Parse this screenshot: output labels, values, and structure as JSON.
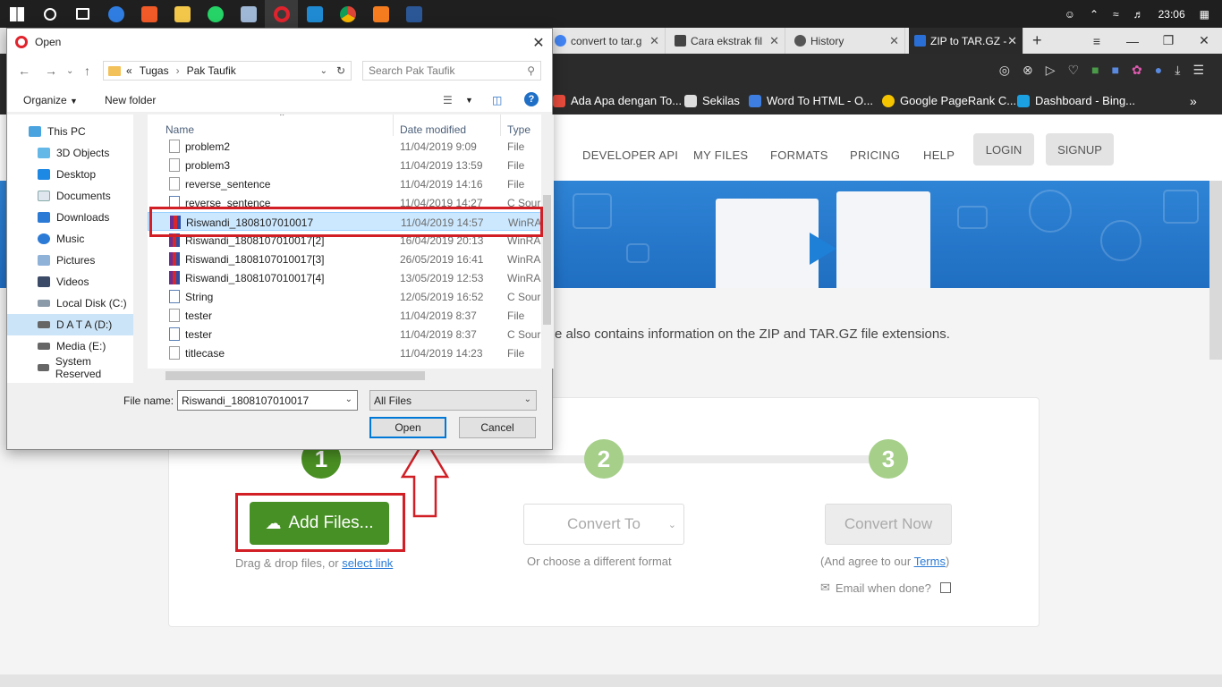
{
  "taskbar": {
    "icons": [
      "windows-start-icon",
      "search-icon",
      "task-view-icon",
      "edge-icon",
      "photo-app-icon",
      "file-explorer-icon",
      "whatsapp-icon",
      "notepad-icon",
      "opera-icon",
      "vscode-icon",
      "chrome-icon",
      "xampp-icon",
      "word-icon"
    ],
    "time": "23:06"
  },
  "browser": {
    "tabs": [
      {
        "title": "convert to tar.g",
        "icon_color": "#4285f4"
      },
      {
        "title": "Cara ekstrak fil",
        "icon_color": "#444444"
      },
      {
        "title": "History",
        "icon_color": "#555555"
      },
      {
        "title": "ZIP to TAR.GZ -",
        "icon_color": "#2a6fd6"
      }
    ],
    "bookmarks": [
      {
        "label": "Ada Apa dengan To...",
        "icon_color": "#e74c3c"
      },
      {
        "label": "Sekilas",
        "icon_color": "#dddddd"
      },
      {
        "label": "Word To HTML - O...",
        "icon_color": "#3d7ee0"
      },
      {
        "label": "Google PageRank C...",
        "icon_color": "#f5c400"
      },
      {
        "label": "Dashboard - Bing...",
        "icon_color": "#1ba1e2"
      }
    ]
  },
  "site": {
    "nav": [
      "DEVELOPER API",
      "MY FILES",
      "FORMATS",
      "PRICING",
      "HELP"
    ],
    "login": "LOGIN",
    "signup": "SIGNUP",
    "info_text": "e also contains information on the ZIP and TAR.GZ file extensions.",
    "steps": [
      "1",
      "2",
      "3"
    ],
    "add_files": "Add Files...",
    "drag_text": "Drag & drop files, or ",
    "select_link": "select link",
    "convert_to": "Convert To",
    "choose_format": "Or choose a different format",
    "convert_now": "Convert Now",
    "agree_prefix": "(And agree to our ",
    "terms": "Terms",
    "agree_suffix": ")",
    "email_when_done": "Email when done?",
    "colors": {
      "green": "#479025",
      "step_active": "#4a8f23",
      "step_inactive": "#a6cf8a",
      "hero": "#2f84d6"
    }
  },
  "dialog": {
    "title": "Open",
    "path": {
      "prefix": "«",
      "parts": [
        "Tugas",
        "Pak Taufik"
      ]
    },
    "search_placeholder": "Search Pak Taufik",
    "organize": "Organize",
    "new_folder": "New folder",
    "nav_items": [
      "This PC",
      "3D Objects",
      "Desktop",
      "Documents",
      "Downloads",
      "Music",
      "Pictures",
      "Videos",
      "Local Disk (C:)",
      "D A T A (D:)",
      "Media (E:)",
      "System Reserved"
    ],
    "columns": {
      "name": "Name",
      "date": "Date modified",
      "type": "Type"
    },
    "files": [
      {
        "name": "problem2",
        "date": "11/04/2019 9:09",
        "type": "File",
        "kind": "file"
      },
      {
        "name": "problem3",
        "date": "11/04/2019 13:59",
        "type": "File",
        "kind": "file"
      },
      {
        "name": "reverse_sentence",
        "date": "11/04/2019 14:16",
        "type": "File",
        "kind": "file"
      },
      {
        "name": "reverse_sentence",
        "date": "11/04/2019 14:27",
        "type": "C Sour",
        "kind": "c"
      },
      {
        "name": "Riswandi_1808107010017",
        "date": "11/04/2019 14:57",
        "type": "WinRA",
        "kind": "rar"
      },
      {
        "name": "Riswandi_1808107010017[2]",
        "date": "16/04/2019 20:13",
        "type": "WinRA",
        "kind": "rar"
      },
      {
        "name": "Riswandi_1808107010017[3]",
        "date": "26/05/2019 16:41",
        "type": "WinRA",
        "kind": "rar"
      },
      {
        "name": "Riswandi_1808107010017[4]",
        "date": "13/05/2019 12:53",
        "type": "WinRA",
        "kind": "rar"
      },
      {
        "name": "String",
        "date": "12/05/2019 16:52",
        "type": "C Sour",
        "kind": "c"
      },
      {
        "name": "tester",
        "date": "11/04/2019 8:37",
        "type": "File",
        "kind": "file"
      },
      {
        "name": "tester",
        "date": "11/04/2019 8:37",
        "type": "C Sour",
        "kind": "c"
      },
      {
        "name": "titlecase",
        "date": "11/04/2019 14:23",
        "type": "File",
        "kind": "file"
      }
    ],
    "file_name_label": "File name:",
    "file_name_value": "Riswandi_1808107010017",
    "file_type": "All Files",
    "open": "Open",
    "cancel": "Cancel"
  }
}
